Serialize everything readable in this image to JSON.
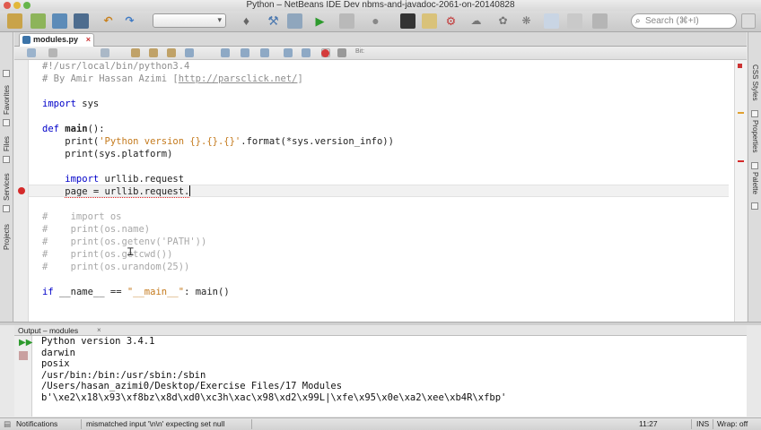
{
  "window": {
    "title": "Python – NetBeans IDE Dev nbms-and-javadoc-2061-on-20140828"
  },
  "toolbar": {
    "items": [
      "new-project-icon",
      "new-file-icon",
      "open-project-icon",
      "save-all-icon",
      "undo-icon",
      "redo-icon"
    ],
    "config_value": "",
    "search_placeholder": "Search (⌘+I)"
  },
  "left_rail": {
    "tabs": [
      "Favorites",
      "Files",
      "Services",
      "Projects"
    ]
  },
  "right_rail": {
    "tabs": [
      "CSS Styles",
      "Properties",
      "Palette"
    ]
  },
  "editor": {
    "tab_label": "modules.py",
    "lines": {
      "l1": "#!/usr/local/bin/python3.4",
      "l2a": "# By Amir Hassan Azimi [",
      "l2b": "http://parsclick.net/",
      "l2c": "]",
      "l4a": "import",
      "l4b": " sys",
      "l6a": "def",
      "l6b": "main",
      "l6c": "():",
      "l7a": "    print(",
      "l7b": "'Python version {}.{}.{}'",
      "l7c": ".format(*sys.version_info))",
      "l8": "    print(sys.platform)",
      "l10a": "    import",
      "l10b": " urllib.request",
      "l11a": "    ",
      "l11b": "page = urllib.request.",
      "l13": "#    import os",
      "l14": "#    print(os.name)",
      "l15": "#    print(os.getenv('PATH'))",
      "l16": "#    print(os.getcwd())",
      "l17": "#    print(os.urandom(25))",
      "l19a": "if",
      "l19b": " __name__ == ",
      "l19c": "\"__main__\"",
      "l19d": ": main()"
    }
  },
  "output": {
    "tab_label": "Output – modules",
    "lines": [
      "Python version 3.4.1",
      "darwin",
      "posix",
      "/usr/bin:/bin:/usr/sbin:/sbin",
      "/Users/hasan_azimi0/Desktop/Exercise Files/17 Modules",
      "b'\\xe2\\x18\\x93\\xf8bz\\x8d\\xd0\\xc3h\\xac\\x98\\xd2\\x99L|\\xfe\\x95\\x0e\\xa2\\xee\\xb4R\\xfbp'"
    ]
  },
  "statusbar": {
    "notifications": "Notifications",
    "message": "mismatched input '\\n\\n' expecting set null",
    "position": "11:27",
    "mode": "INS",
    "wrap": "Wrap: off"
  },
  "colors": {
    "keyword": "#0000c9",
    "string": "#c47a1d",
    "comment": "#8e8e8e",
    "error": "#d42a2a"
  }
}
